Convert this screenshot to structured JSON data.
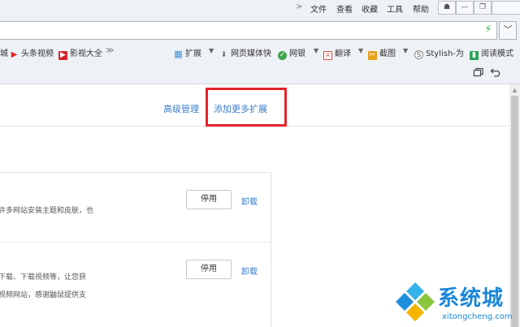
{
  "menubar": {
    "chevron": ">",
    "items": [
      "文件",
      "查看",
      "收藏",
      "工具",
      "帮助"
    ],
    "window_buttons": [
      "☗",
      "—",
      "❐"
    ]
  },
  "address": {
    "value": "",
    "bolt_icon": "⚡",
    "dropdown_icon": "﹀"
  },
  "bookmarks": {
    "items": [
      {
        "label": "城",
        "icon": ""
      },
      {
        "label": "头条视频",
        "icon": "▶",
        "color": "#e22b2b"
      },
      {
        "label": "影视大全",
        "icon": "▶",
        "color": "#d3262d"
      },
      {
        "label": "扩展",
        "icon": "▦",
        "color": "#3c8fd9"
      },
      {
        "label": "网页媒体快",
        "icon": "⬇",
        "color": "#6a6a6a"
      },
      {
        "label": "网银",
        "icon": "✓",
        "color": "#3fa34d"
      },
      {
        "label": "翻译",
        "icon": "A",
        "color": "#e24a3b"
      },
      {
        "label": "截图",
        "icon": "✂",
        "color": "#e8a21b"
      },
      {
        "label": "Stylish-为",
        "icon": "S",
        "color": "#888888"
      },
      {
        "label": "阅读模式",
        "icon": "▮",
        "color": "#2aa55a"
      }
    ],
    "more": "≫"
  },
  "toolrow": {
    "icons": [
      "restore-icon",
      "undo-icon"
    ]
  },
  "header": {
    "advanced_label": "高级管理",
    "add_more_label": "添加更多扩展"
  },
  "extensions": [
    {
      "desc_lines": [
        "许多网站安装主题和皮肤，也"
      ],
      "disable_label": "停用",
      "uninstall_label": "卸载"
    },
    {
      "desc_lines": [
        "下载、下载视频等，让您获",
        "视频网站，感谢鼬鼠提供支"
      ],
      "disable_label": "停用",
      "uninstall_label": "卸载"
    }
  ],
  "watermark": {
    "title": "系统城",
    "url": "xitongcheng.com"
  },
  "colors": {
    "link_blue": "#3b7cc8",
    "highlight_red": "#e3242b",
    "watermark_blue": "#1a87d8"
  }
}
